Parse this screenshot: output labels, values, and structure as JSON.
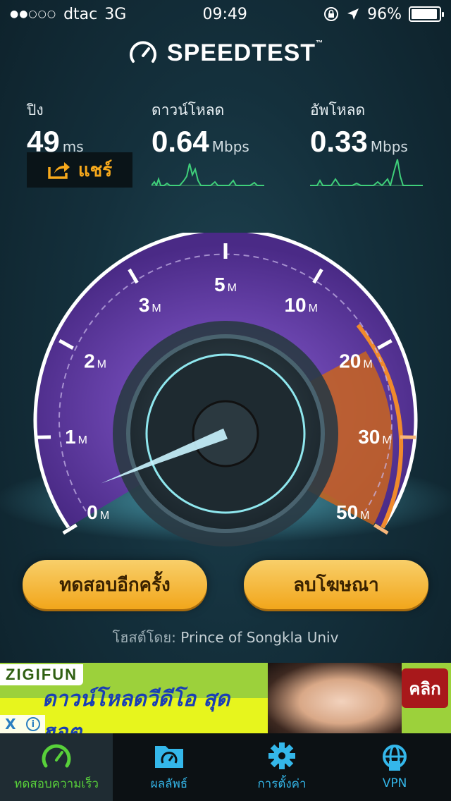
{
  "status_bar": {
    "carrier": "dtac",
    "network": "3G",
    "time": "09:49",
    "battery": "96%",
    "battery_level": 0.96
  },
  "app": {
    "title": "SPEEDTEST",
    "tm": "™"
  },
  "stats": {
    "ping": {
      "label": "ปิง",
      "value": "49",
      "unit": "ms"
    },
    "download": {
      "label": "ดาวน์โหลด",
      "value": "0.64",
      "unit": "Mbps"
    },
    "upload": {
      "label": "อัพโหลด",
      "value": "0.33",
      "unit": "Mbps"
    },
    "share_label": "แชร์"
  },
  "gauge": {
    "labels": [
      {
        "value": "0",
        "unit": "M"
      },
      {
        "value": "1",
        "unit": "M"
      },
      {
        "value": "2",
        "unit": "M"
      },
      {
        "value": "3",
        "unit": "M"
      },
      {
        "value": "5",
        "unit": "M"
      },
      {
        "value": "10",
        "unit": "M"
      },
      {
        "value": "20",
        "unit": "M"
      },
      {
        "value": "30",
        "unit": "M"
      },
      {
        "value": "50",
        "unit": "M"
      }
    ],
    "needle_fraction": 0.04,
    "colors": {
      "purple": "#6a3fb5",
      "orange": "#f08a2c",
      "cyan": "#7fe6ff"
    }
  },
  "actions": {
    "retest_label": "ทดสอบอีกครั้ง",
    "remove_ads_label": "ลบโฆษณา"
  },
  "host": {
    "prefix": "โฮสต์โดย: ",
    "name": "Prince of Songkla Univ"
  },
  "ad": {
    "brand": "ZIGIFUN",
    "text": "ดาวน์โหลดวีดีโอ สุดฮอต",
    "click_label": "คลิก",
    "close_label": "X",
    "info_label": "i"
  },
  "tabs": [
    {
      "label": "ทดสอบความเร็ว",
      "icon": "speedometer-icon",
      "active": true
    },
    {
      "label": "ผลลัพธ์",
      "icon": "folder-icon",
      "active": false
    },
    {
      "label": "การตั้งค่า",
      "icon": "gear-icon",
      "active": false
    },
    {
      "label": "VPN",
      "icon": "vpn-globe-icon",
      "active": false
    }
  ]
}
